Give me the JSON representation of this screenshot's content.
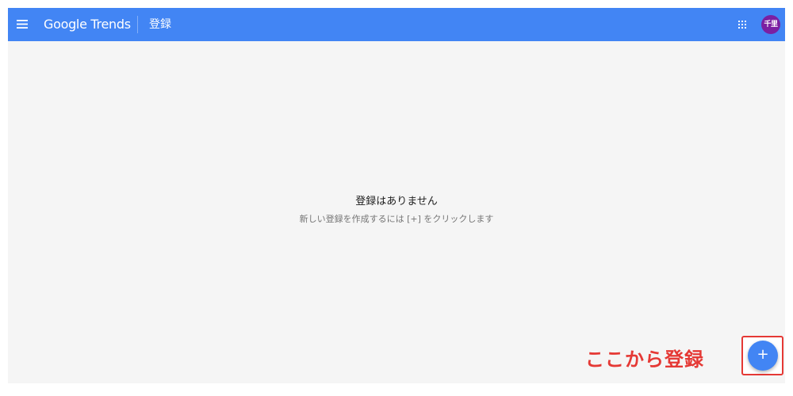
{
  "header": {
    "brand": "Google Trends",
    "page_title": "登録",
    "avatar_text": "千里",
    "background_color": "#4285f4",
    "menu_icon": "hamburger-menu-icon",
    "apps_icon": "apps-grid-icon"
  },
  "main": {
    "empty_title": "登録はありません",
    "empty_subtitle": "新しい登録を作成するには [+] をクリックします"
  },
  "fab": {
    "label": "+"
  },
  "annotation": {
    "text": "ここから登録",
    "color": "#e53935"
  }
}
